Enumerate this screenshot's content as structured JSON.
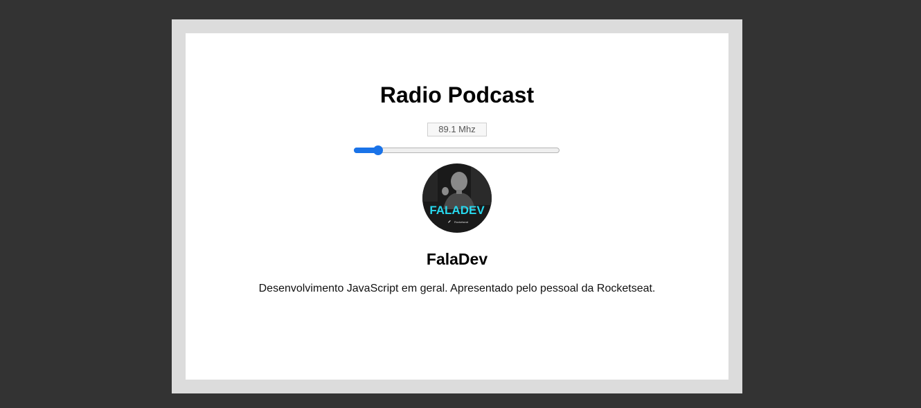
{
  "app": {
    "title": "Radio Podcast"
  },
  "tuner": {
    "frequency_label": "89.1 Mhz",
    "slider_fraction": 0.1
  },
  "podcast": {
    "cover_text": "FALADEV",
    "cover_subtext": "Rocketseat",
    "name": "FalaDev",
    "description": "Desenvolvimento JavaScript em geral. Apresentado pelo pessoal da Rocketseat."
  },
  "colors": {
    "background": "#333333",
    "frame": "#dcdcdc",
    "accent": "#1a73e8",
    "cover_text": "#27d8ee"
  }
}
